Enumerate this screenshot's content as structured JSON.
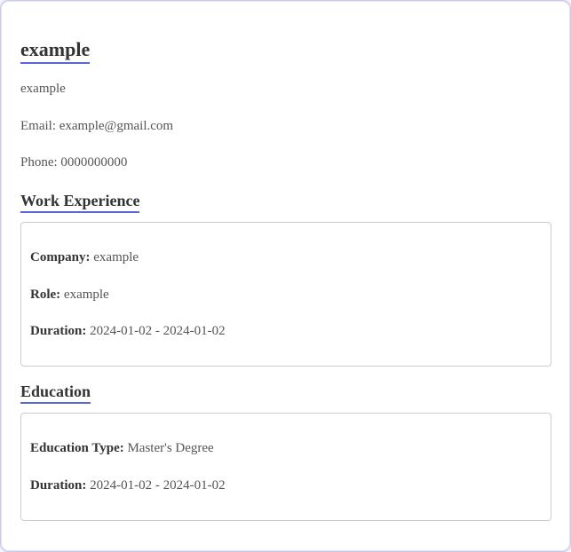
{
  "profile": {
    "name": "example",
    "summary": "example",
    "email_line": "Email: example@gmail.com",
    "phone_line": "Phone: 0000000000"
  },
  "work": {
    "title": "Work Experience",
    "items": [
      {
        "company_label": "Company:",
        "company": " example",
        "role_label": "Role:",
        "role": " example",
        "duration_label": "Duration:",
        "duration": " 2024-01-02 - 2024-01-02"
      }
    ]
  },
  "education": {
    "title": "Education",
    "items": [
      {
        "type_label": "Education Type:",
        "type": " Master's Degree",
        "duration_label": "Duration:",
        "duration": " 2024-01-02 - 2024-01-02"
      }
    ]
  }
}
